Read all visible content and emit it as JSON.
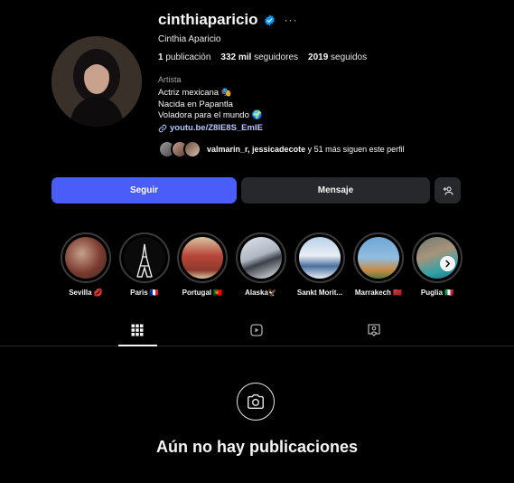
{
  "profile": {
    "username": "cinthiaparicio",
    "more_icon": "···",
    "full_name": "Cinthia Aparicio",
    "stats": [
      {
        "value": "1",
        "label": "publicación"
      },
      {
        "value": "332 mil",
        "label": "seguidores"
      },
      {
        "value": "2019",
        "label": "seguidos"
      }
    ],
    "category": "Artista",
    "bio_lines": [
      "Actriz mexicana 🎭",
      "Nacida en Papantla",
      "Voladora para el mundo 🌍"
    ],
    "link": "youtu.be/Z8IE8S_EmIE",
    "followers_names": "valmarin_r, jessicadecote",
    "followers_rest": " y 51 más siguen este perfil"
  },
  "actions": {
    "follow": "Seguir",
    "message": "Mensaje"
  },
  "highlights": [
    {
      "label": "Sevilla 💋",
      "colors": [
        "#7a3b2e",
        "#c9a08a"
      ]
    },
    {
      "label": "Paris 🇫🇷",
      "colors": [
        "#0a0a0a",
        "#ececec"
      ]
    },
    {
      "label": "Portugal 🇵🇹",
      "colors": [
        "#8c3a2c",
        "#d8c6a0"
      ]
    },
    {
      "label": "Alaska🦅",
      "colors": [
        "#dfe4ea",
        "#3b3f48"
      ]
    },
    {
      "label": "Sankt Morit...",
      "colors": [
        "#e9eef3",
        "#4a6fa0"
      ]
    },
    {
      "label": "Marrakech 🇲🇦",
      "colors": [
        "#6fa7d6",
        "#c88a44"
      ]
    },
    {
      "label": "Puglia 🇮🇹",
      "colors": [
        "#6b7a6e",
        "#2fa0a8"
      ]
    }
  ],
  "empty_state": {
    "title": "Aún no hay publicaciones"
  }
}
